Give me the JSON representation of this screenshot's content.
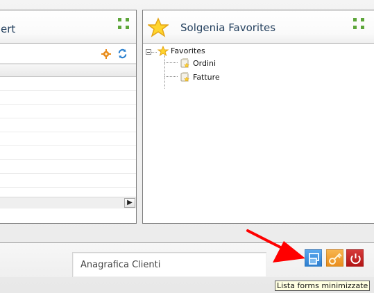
{
  "left_panel": {
    "title_fragment": "ert"
  },
  "favorites_panel": {
    "title": "Solgenia Favorites",
    "tree": {
      "root_label": "Favorites",
      "children": [
        "Ordini",
        "Fatture"
      ]
    }
  },
  "bottom": {
    "window_title": "Anagrafica Clienti"
  },
  "tooltip": {
    "text": "Lista forms minimizzate"
  },
  "toolbar_icons": {
    "left": [
      "gear-icon",
      "refresh-icon"
    ],
    "right": [
      "resize-icon"
    ],
    "bottom": [
      "restore-windows-icon",
      "key-icon",
      "power-icon"
    ]
  },
  "colors": {
    "panel_title": "#24405e",
    "blue_button": "#3f8fdf",
    "orange_button": "#f09a2b",
    "red_button": "#c62626",
    "arrow": "#ff0000",
    "tooltip_bg": "#ffffe1"
  }
}
